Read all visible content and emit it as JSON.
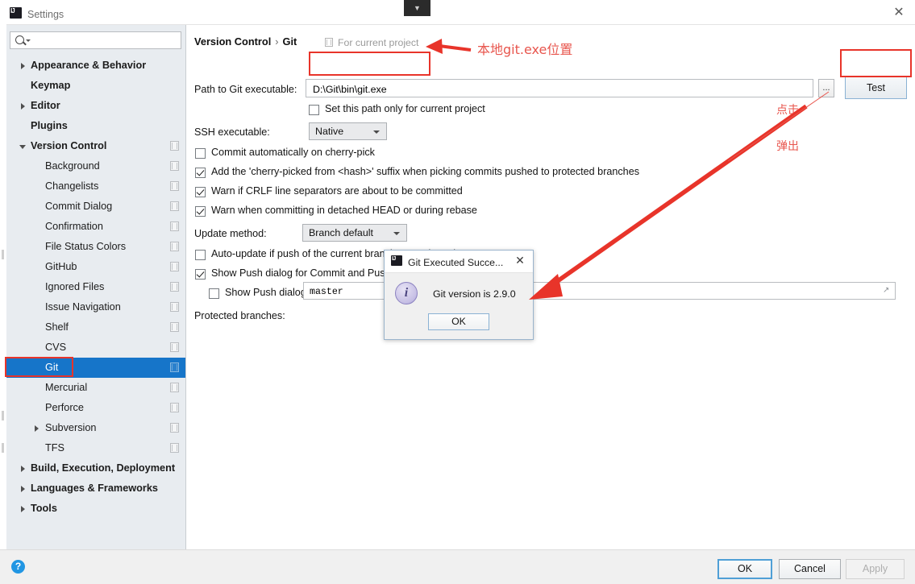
{
  "window": {
    "title": "Settings",
    "app_icon": "intellij-icon",
    "close_icon": "close-icon",
    "tab_chevron_icon": "chevron-down-icon"
  },
  "sidebar": {
    "search": {
      "value": "",
      "placeholder": "",
      "icon": "search-icon",
      "caret_icon": "chevron-down-icon"
    },
    "items": [
      {
        "label": "Appearance & Behavior",
        "indent": 0,
        "bold": true,
        "arrow": "collapsed",
        "config_icon": false,
        "selected": false
      },
      {
        "label": "Keymap",
        "indent": 0,
        "bold": true,
        "arrow": "none",
        "config_icon": false,
        "selected": false
      },
      {
        "label": "Editor",
        "indent": 0,
        "bold": true,
        "arrow": "collapsed",
        "config_icon": false,
        "selected": false
      },
      {
        "label": "Plugins",
        "indent": 0,
        "bold": true,
        "arrow": "none",
        "config_icon": false,
        "selected": false
      },
      {
        "label": "Version Control",
        "indent": 0,
        "bold": true,
        "arrow": "expanded",
        "config_icon": true,
        "selected": false
      },
      {
        "label": "Background",
        "indent": 1,
        "bold": false,
        "arrow": "none",
        "config_icon": true,
        "selected": false
      },
      {
        "label": "Changelists",
        "indent": 1,
        "bold": false,
        "arrow": "none",
        "config_icon": true,
        "selected": false
      },
      {
        "label": "Commit Dialog",
        "indent": 1,
        "bold": false,
        "arrow": "none",
        "config_icon": true,
        "selected": false
      },
      {
        "label": "Confirmation",
        "indent": 1,
        "bold": false,
        "arrow": "none",
        "config_icon": true,
        "selected": false
      },
      {
        "label": "File Status Colors",
        "indent": 1,
        "bold": false,
        "arrow": "none",
        "config_icon": true,
        "selected": false
      },
      {
        "label": "GitHub",
        "indent": 1,
        "bold": false,
        "arrow": "none",
        "config_icon": true,
        "selected": false
      },
      {
        "label": "Ignored Files",
        "indent": 1,
        "bold": false,
        "arrow": "none",
        "config_icon": true,
        "selected": false
      },
      {
        "label": "Issue Navigation",
        "indent": 1,
        "bold": false,
        "arrow": "none",
        "config_icon": true,
        "selected": false
      },
      {
        "label": "Shelf",
        "indent": 1,
        "bold": false,
        "arrow": "none",
        "config_icon": true,
        "selected": false
      },
      {
        "label": "CVS",
        "indent": 1,
        "bold": false,
        "arrow": "none",
        "config_icon": true,
        "selected": false
      },
      {
        "label": "Git",
        "indent": 1,
        "bold": false,
        "arrow": "none",
        "config_icon": true,
        "selected": true
      },
      {
        "label": "Mercurial",
        "indent": 1,
        "bold": false,
        "arrow": "none",
        "config_icon": true,
        "selected": false
      },
      {
        "label": "Perforce",
        "indent": 1,
        "bold": false,
        "arrow": "none",
        "config_icon": true,
        "selected": false
      },
      {
        "label": "Subversion",
        "indent": 1,
        "bold": false,
        "arrow": "collapsed",
        "config_icon": true,
        "selected": false
      },
      {
        "label": "TFS",
        "indent": 1,
        "bold": false,
        "arrow": "none",
        "config_icon": true,
        "selected": false
      },
      {
        "label": "Build, Execution, Deployment",
        "indent": 0,
        "bold": true,
        "arrow": "collapsed",
        "config_icon": false,
        "selected": false
      },
      {
        "label": "Languages & Frameworks",
        "indent": 0,
        "bold": true,
        "arrow": "collapsed",
        "config_icon": false,
        "selected": false
      },
      {
        "label": "Tools",
        "indent": 0,
        "bold": true,
        "arrow": "collapsed",
        "config_icon": false,
        "selected": false
      }
    ],
    "selected_color": "#1675c9"
  },
  "main": {
    "breadcrumb_parent": "Version Control",
    "breadcrumb_separator": "›",
    "breadcrumb_current": "Git",
    "for_current_project": "For current project",
    "path_label": "Path to Git executable:",
    "path_value": "D:\\Git\\bin\\git.exe",
    "browse_label": "...",
    "test_label": "Test",
    "set_path_only_label": "Set this path only for current project",
    "set_path_only_checked": false,
    "ssh_label": "SSH executable:",
    "ssh_value": "Native",
    "checkboxes": [
      {
        "label": "Commit automatically on cherry-pick",
        "checked": false
      },
      {
        "label": "Add the 'cherry-picked from <hash>' suffix when picking commits pushed to protected branches",
        "checked": true
      },
      {
        "label": "Warn if CRLF line separators are about to be committed",
        "checked": true
      },
      {
        "label": "Warn when committing in detached HEAD or during rebase",
        "checked": true
      }
    ],
    "update_method_label": "Update method:",
    "update_method_value": "Branch default",
    "auto_update_label": "Auto-update if push of the current branch was rejected",
    "auto_update_checked": false,
    "show_push_label": "Show Push dialog for Commit and Push",
    "show_push_checked": true,
    "show_push_only_label": "Show Push dialog only when committing to protected branches",
    "show_push_only_checked": false,
    "protected_branches_label": "Protected branches:",
    "protected_branches_value": "master",
    "expand_icon": "expand-icon"
  },
  "dialog": {
    "title": "Git Executed Succe...",
    "app_icon": "intellij-icon",
    "close_icon": "close-icon",
    "info_icon": "info-icon",
    "message": "Git version is 2.9.0",
    "ok_label": "OK"
  },
  "footer": {
    "help_icon": "help-icon",
    "ok_label": "OK",
    "cancel_label": "Cancel",
    "apply_label": "Apply",
    "apply_disabled": true
  },
  "annotations": {
    "color": "#e8342a",
    "text_color": "#e8564e",
    "path_note": "本地git.exe位置",
    "click_note": "点击",
    "popup_note": "弹出"
  }
}
